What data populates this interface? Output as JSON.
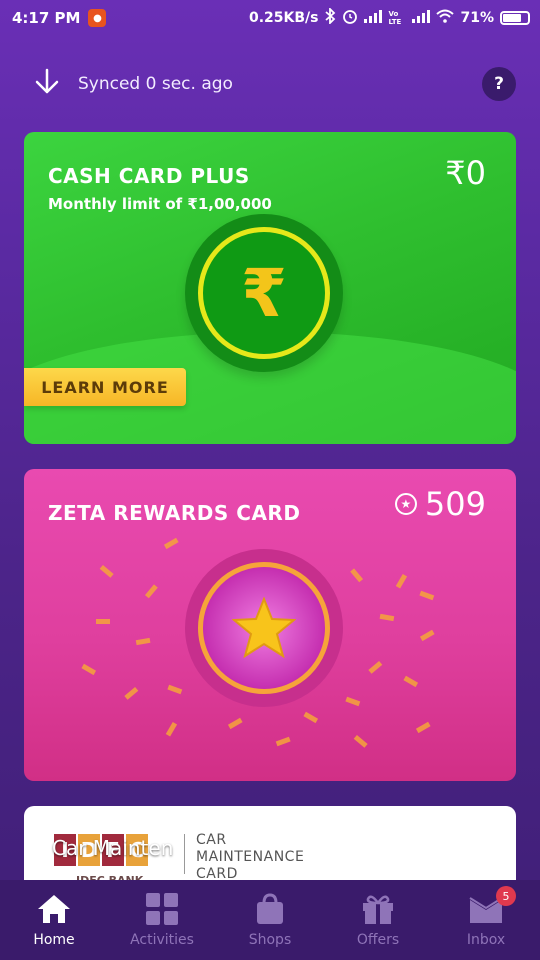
{
  "status_bar": {
    "time": "4:17 PM",
    "speed": "0.25KB/s",
    "battery": "71%",
    "signal_label": "Vo LTE",
    "notification_icon": "mi-notification-icon"
  },
  "sync": {
    "text": "Synced 0 sec. ago",
    "help_label": "?"
  },
  "cash_card": {
    "title": "CASH CARD PLUS",
    "subtitle": "Monthly limit of ₹1,00,000",
    "amount": "₹0",
    "coin_symbol": "₹",
    "cta": "LEARN MORE",
    "colors": {
      "background": "#2fbf2f",
      "coin": "#0f9a14",
      "ring": "#e6e81a",
      "cta": "#fdd84a"
    }
  },
  "rewards_card": {
    "title": "ZETA REWARDS CARD",
    "points": "509",
    "points_icon": "star-circle-icon",
    "colors": {
      "background": "#df3f9e",
      "ring": "#f6a43a",
      "star": "#f8c41b"
    }
  },
  "idfc_card": {
    "logo_letters": [
      "I",
      "D",
      "F",
      "C"
    ],
    "logo_colors": [
      "#a12a3d",
      "#e8a23a",
      "#a12a3d",
      "#e8a23a"
    ],
    "bank_name": "IDFC BANK",
    "card_name_lines": [
      "CAR",
      "MAINTENANCE",
      "CARD"
    ],
    "overlay_text": "Car Mainten"
  },
  "tabs": [
    {
      "label": "Home",
      "icon": "home-icon",
      "active": true
    },
    {
      "label": "Activities",
      "icon": "grid-icon",
      "active": false
    },
    {
      "label": "Shops",
      "icon": "shopping-bag-icon",
      "active": false
    },
    {
      "label": "Offers",
      "icon": "gift-icon",
      "active": false
    },
    {
      "label": "Inbox",
      "icon": "inbox-icon",
      "active": false,
      "badge": "5"
    }
  ]
}
